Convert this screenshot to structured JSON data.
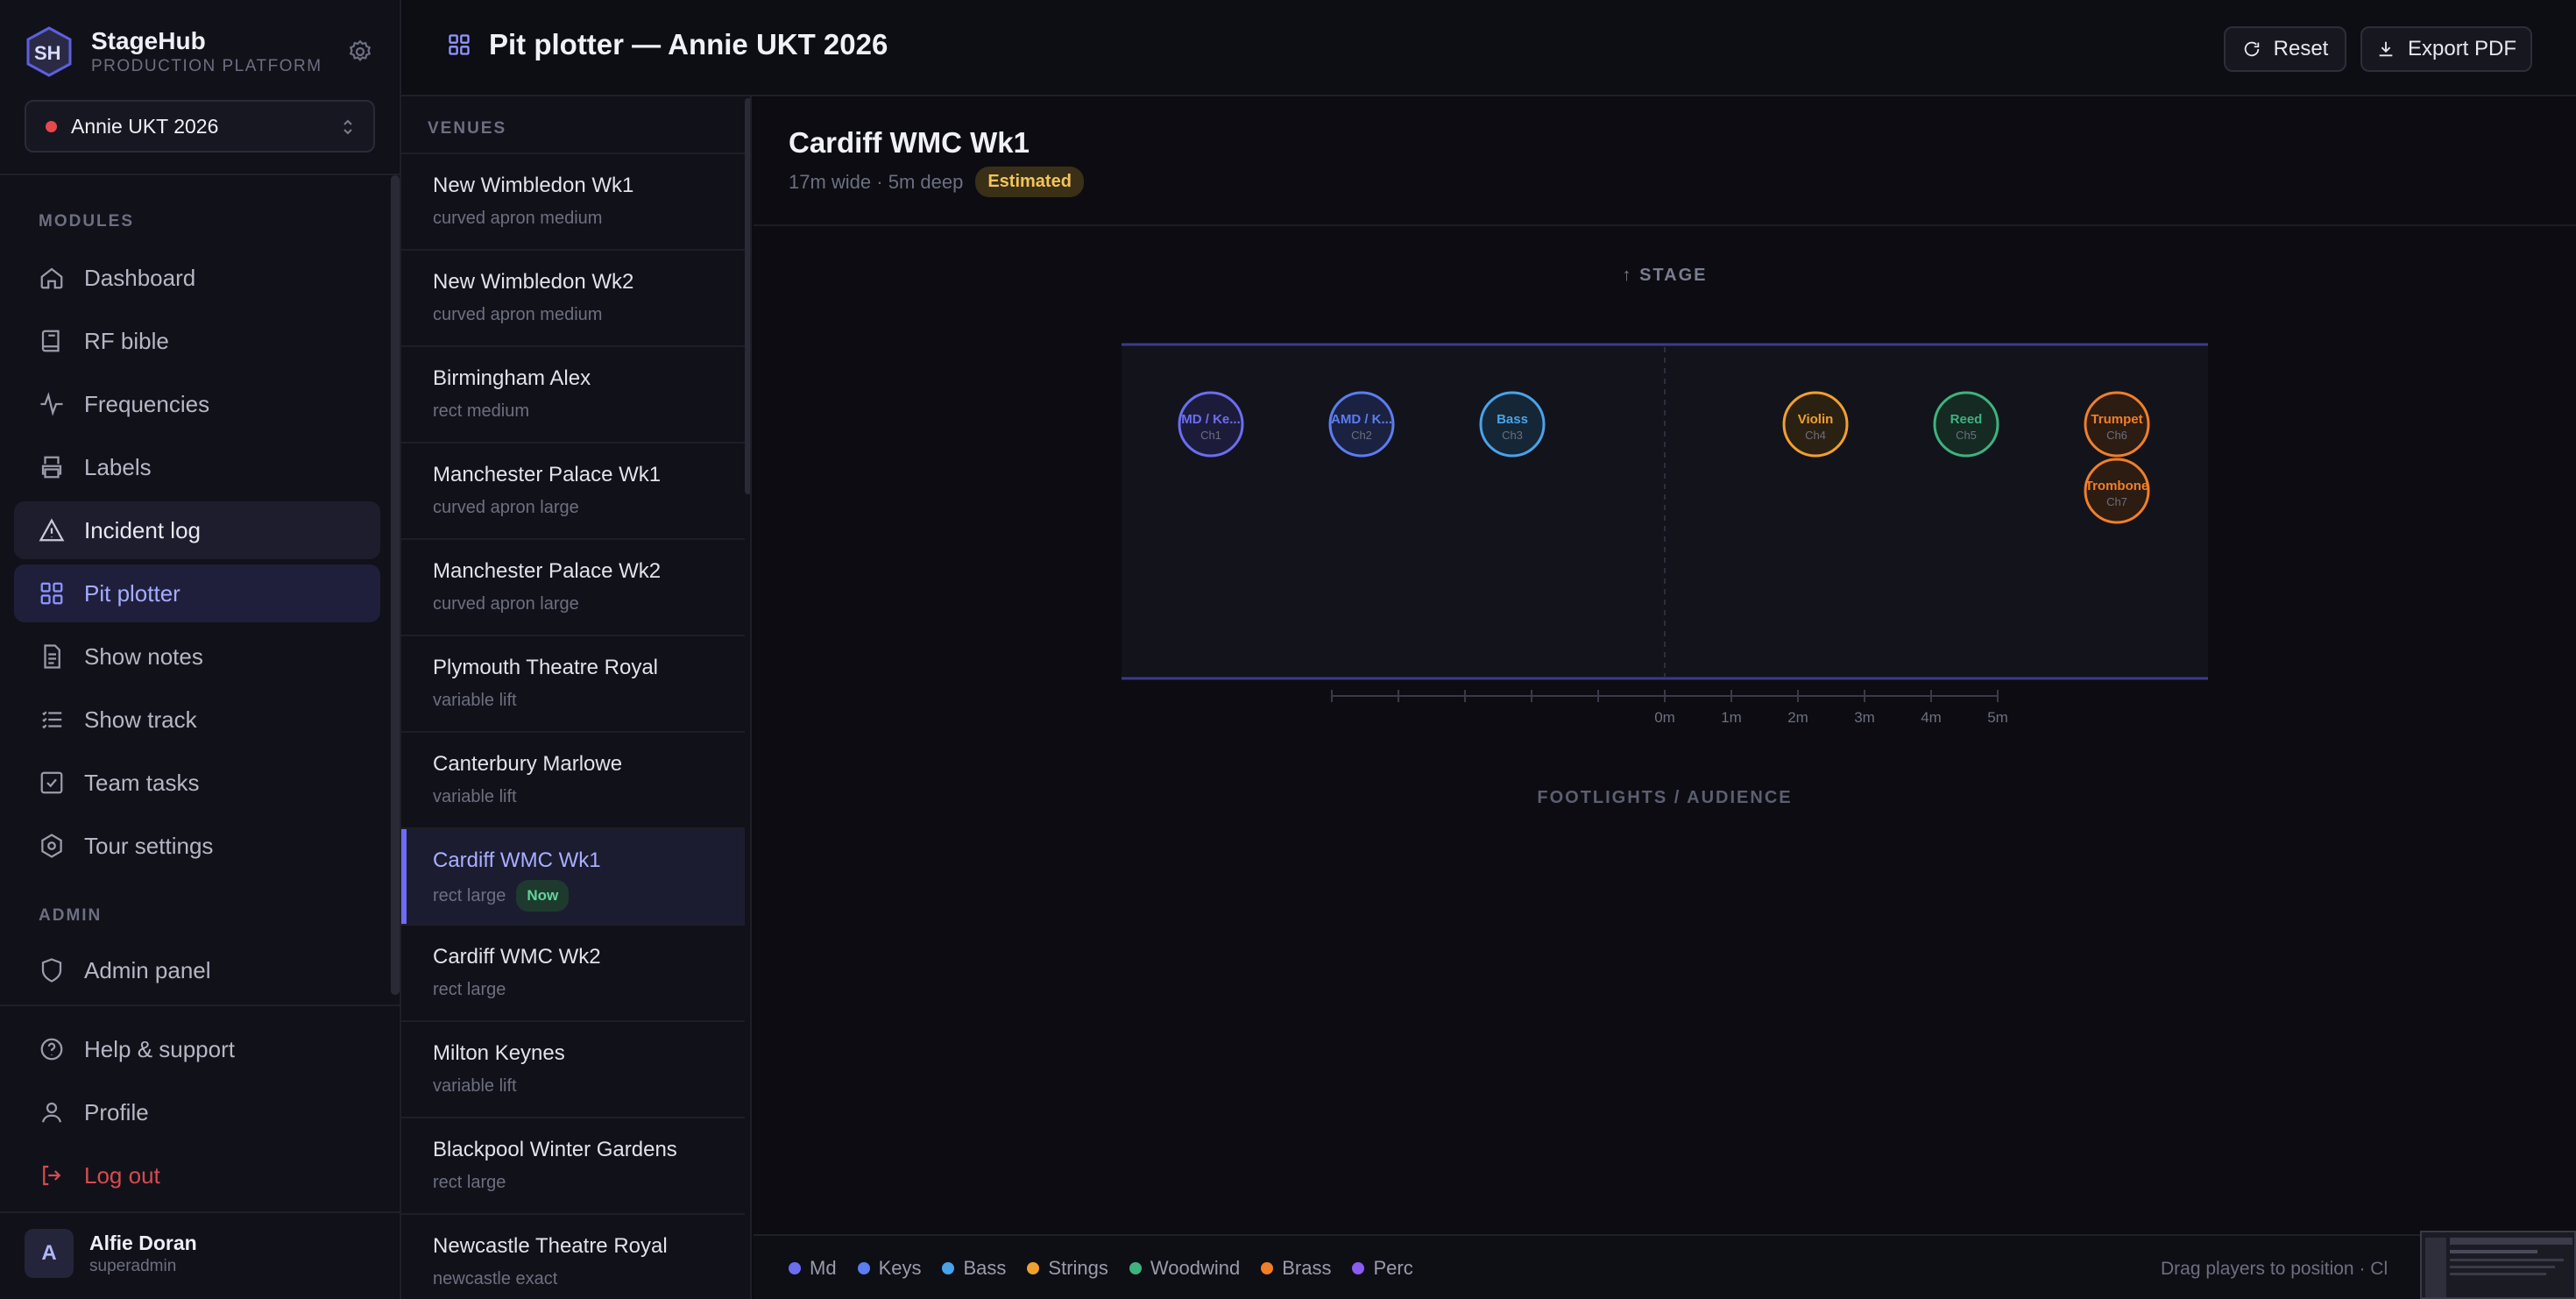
{
  "brand": {
    "name": "StageHub",
    "subtitle": "PRODUCTION PLATFORM",
    "logo_letters": "SH"
  },
  "tour_select": {
    "value": "Annie UKT 2026",
    "status_color": "#e5484d"
  },
  "sidebar": {
    "modules_label": "MODULES",
    "admin_label": "ADMIN",
    "items": [
      {
        "label": "Dashboard",
        "icon": "home-icon"
      },
      {
        "label": "RF bible",
        "icon": "book-icon"
      },
      {
        "label": "Frequencies",
        "icon": "waveform-icon"
      },
      {
        "label": "Labels",
        "icon": "printer-icon"
      },
      {
        "label": "Incident log",
        "icon": "warning-icon"
      },
      {
        "label": "Pit plotter",
        "icon": "grid-icon"
      },
      {
        "label": "Show notes",
        "icon": "notes-icon"
      },
      {
        "label": "Show track",
        "icon": "list-icon"
      },
      {
        "label": "Team tasks",
        "icon": "checkbox-icon"
      },
      {
        "label": "Tour settings",
        "icon": "settings-icon"
      }
    ],
    "admin_items": [
      {
        "label": "Admin panel",
        "icon": "shield-icon"
      }
    ],
    "footer_items": [
      {
        "label": "Help & support",
        "icon": "help-icon"
      },
      {
        "label": "Profile",
        "icon": "user-icon"
      },
      {
        "label": "Log out",
        "icon": "logout-icon"
      }
    ]
  },
  "user": {
    "initial": "A",
    "name": "Alfie Doran",
    "role": "superadmin"
  },
  "header": {
    "title": "Pit plotter — Annie UKT 2026",
    "reset_label": "Reset",
    "export_label": "Export PDF"
  },
  "venues": {
    "heading": "VENUES",
    "items": [
      {
        "name": "New Wimbledon Wk1",
        "sub": "curved apron medium"
      },
      {
        "name": "New Wimbledon Wk2",
        "sub": "curved apron medium"
      },
      {
        "name": "Birmingham Alex",
        "sub": "rect medium"
      },
      {
        "name": "Manchester Palace Wk1",
        "sub": "curved apron large"
      },
      {
        "name": "Manchester Palace Wk2",
        "sub": "curved apron large"
      },
      {
        "name": "Plymouth Theatre Royal",
        "sub": "variable lift"
      },
      {
        "name": "Canterbury Marlowe",
        "sub": "variable lift"
      },
      {
        "name": "Cardiff WMC Wk1",
        "sub": "rect large",
        "badge": "Now",
        "active": true
      },
      {
        "name": "Cardiff WMC Wk2",
        "sub": "rect large"
      },
      {
        "name": "Milton Keynes",
        "sub": "variable lift"
      },
      {
        "name": "Blackpool Winter Gardens",
        "sub": "rect large"
      },
      {
        "name": "Newcastle Theatre Royal",
        "sub": "newcastle exact"
      }
    ]
  },
  "plot": {
    "venue_title": "Cardiff WMC Wk1",
    "venue_meta": "17m wide · 5m deep",
    "estimate_badge": "Estimated",
    "stage_label": "↑ STAGE",
    "footlights_label": "FOOTLIGHTS / AUDIENCE",
    "scale_labels": [
      "0m",
      "1m",
      "2m",
      "3m",
      "4m",
      "5m"
    ],
    "players": [
      {
        "label": "MD / Ke...",
        "channel": "Ch1",
        "section": "Md"
      },
      {
        "label": "AMD / K...",
        "channel": "Ch2",
        "section": "Keys"
      },
      {
        "label": "Bass",
        "channel": "Ch3",
        "section": "Bass"
      },
      {
        "label": "Violin",
        "channel": "Ch4",
        "section": "Strings"
      },
      {
        "label": "Reed",
        "channel": "Ch5",
        "section": "Woodwind"
      },
      {
        "label": "Trumpet",
        "channel": "Ch6",
        "section": "Brass"
      },
      {
        "label": "Trombone",
        "channel": "Ch7",
        "section": "Brass"
      }
    ]
  },
  "legend": [
    {
      "label": "Md",
      "color": "#6b6ef0"
    },
    {
      "label": "Keys",
      "color": "#5b7df0"
    },
    {
      "label": "Bass",
      "color": "#4aa3e8"
    },
    {
      "label": "Strings",
      "color": "#f0a030"
    },
    {
      "label": "Woodwind",
      "color": "#3fb27f"
    },
    {
      "label": "Brass",
      "color": "#f07f2a"
    },
    {
      "label": "Perc",
      "color": "#8a5cf0"
    }
  ],
  "hint": "Drag players to position · Cl"
}
